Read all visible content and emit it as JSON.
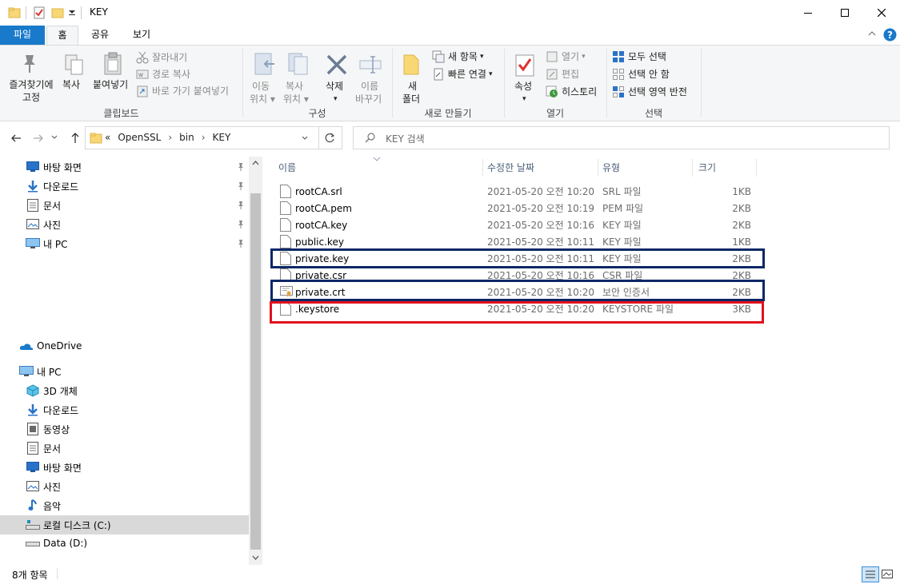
{
  "window": {
    "title": "KEY"
  },
  "tabs": [
    {
      "label": "파일"
    },
    {
      "label": "홈"
    },
    {
      "label": "공유"
    },
    {
      "label": "보기"
    }
  ],
  "ribbon": {
    "clipboard": {
      "pin_label_1": "즐겨찾기에",
      "pin_label_2": "고정",
      "copy": "복사",
      "paste": "붙여넣기",
      "cut": "잘라내기",
      "copy_path": "경로 복사",
      "paste_shortcut": "바로 가기 붙여넣기",
      "group": "클립보드"
    },
    "organize": {
      "move_1": "이동",
      "move_2": "위치",
      "copyto_1": "복사",
      "copyto_2": "위치",
      "delete": "삭제",
      "rename_1": "이름",
      "rename_2": "바꾸기",
      "group": "구성"
    },
    "new": {
      "folder_1": "새",
      "folder_2": "폴더",
      "new_item": "새 항목",
      "easy_access": "빠른 연결",
      "group": "새로 만들기"
    },
    "open": {
      "properties": "속성",
      "open": "열기",
      "edit": "편집",
      "history": "히스토리",
      "group": "열기"
    },
    "select": {
      "select_all": "모두 선택",
      "select_none": "선택 안 함",
      "invert": "선택 영역 반전",
      "group": "선택"
    }
  },
  "address": {
    "prefix": "«",
    "crumbs": [
      "OpenSSL",
      "bin",
      "KEY"
    ],
    "search_placeholder": "KEY 검색"
  },
  "nav": {
    "quick": [
      {
        "label": "바탕 화면",
        "icon": "desktop-icon"
      },
      {
        "label": "다운로드",
        "icon": "download-icon"
      },
      {
        "label": "문서",
        "icon": "documents-icon"
      },
      {
        "label": "사진",
        "icon": "pictures-icon"
      },
      {
        "label": "내 PC",
        "icon": "pc-icon"
      }
    ],
    "onedrive": "OneDrive",
    "thispc": "내 PC",
    "pc_items": [
      {
        "label": "3D 개체",
        "icon": "3d-objects-icon"
      },
      {
        "label": "다운로드",
        "icon": "download-icon"
      },
      {
        "label": "동영상",
        "icon": "videos-icon"
      },
      {
        "label": "문서",
        "icon": "documents-icon"
      },
      {
        "label": "바탕 화면",
        "icon": "desktop-icon"
      },
      {
        "label": "사진",
        "icon": "pictures-icon"
      },
      {
        "label": "음악",
        "icon": "music-icon"
      },
      {
        "label": "로컬 디스크 (C:)",
        "icon": "local-disk-icon"
      },
      {
        "label": "Data (D:)",
        "icon": "drive-icon"
      }
    ]
  },
  "columns": {
    "name": "이름",
    "date": "수정한 날짜",
    "type": "유형",
    "size": "크기"
  },
  "files": [
    {
      "name": "rootCA.srl",
      "date": "2021-05-20 오전 10:20",
      "type": "SRL 파일",
      "size": "1KB"
    },
    {
      "name": "rootCA.pem",
      "date": "2021-05-20 오전 10:19",
      "type": "PEM 파일",
      "size": "2KB"
    },
    {
      "name": "rootCA.key",
      "date": "2021-05-20 오전 10:16",
      "type": "KEY 파일",
      "size": "2KB"
    },
    {
      "name": "public.key",
      "date": "2021-05-20 오전 10:11",
      "type": "KEY 파일",
      "size": "1KB"
    },
    {
      "name": "private.key",
      "date": "2021-05-20 오전 10:11",
      "type": "KEY 파일",
      "size": "2KB"
    },
    {
      "name": "private.csr",
      "date": "2021-05-20 오전 10:16",
      "type": "CSR 파일",
      "size": "2KB"
    },
    {
      "name": "private.crt",
      "date": "2021-05-20 오전 10:20",
      "type": "보안 인증서",
      "size": "2KB"
    },
    {
      "name": ".keystore",
      "date": "2021-05-20 오전 10:20",
      "type": "KEYSTORE 파일",
      "size": "3KB"
    }
  ],
  "highlight_colors": {
    "navy": "#0b2766",
    "red": "#e0121f"
  },
  "status": {
    "count": "8개 항목"
  }
}
